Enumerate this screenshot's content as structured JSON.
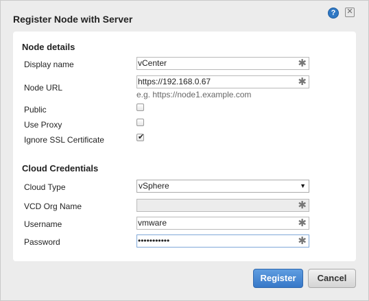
{
  "dialog": {
    "title": "Register Node with Server",
    "help_icon": "?",
    "close_icon": "✕"
  },
  "node_details": {
    "heading": "Node details",
    "display_name": {
      "label": "Display name",
      "value": "vCenter",
      "required": "✱"
    },
    "node_url": {
      "label": "Node URL",
      "value": "https://192.168.0.67",
      "hint": "e.g. https://node1.example.com",
      "required": "✱"
    },
    "public": {
      "label": "Public",
      "checked": false
    },
    "use_proxy": {
      "label": "Use Proxy",
      "checked": false
    },
    "ignore_ssl": {
      "label": "Ignore SSL Certificate",
      "checked": true,
      "mark": "✔"
    }
  },
  "cloud_credentials": {
    "heading": "Cloud Credentials",
    "cloud_type": {
      "label": "Cloud Type",
      "value": "vSphere",
      "arrow": "▼"
    },
    "vcd_org_name": {
      "label": "VCD Org Name",
      "value": "",
      "required": "✱"
    },
    "username": {
      "label": "Username",
      "value": "vmware",
      "required": "✱"
    },
    "password": {
      "label": "Password",
      "value": "•••••••••••",
      "required": "✱"
    }
  },
  "buttons": {
    "register": "Register",
    "cancel": "Cancel"
  },
  "colors": {
    "accent": "#3778c8",
    "help": "#2f78c4"
  }
}
